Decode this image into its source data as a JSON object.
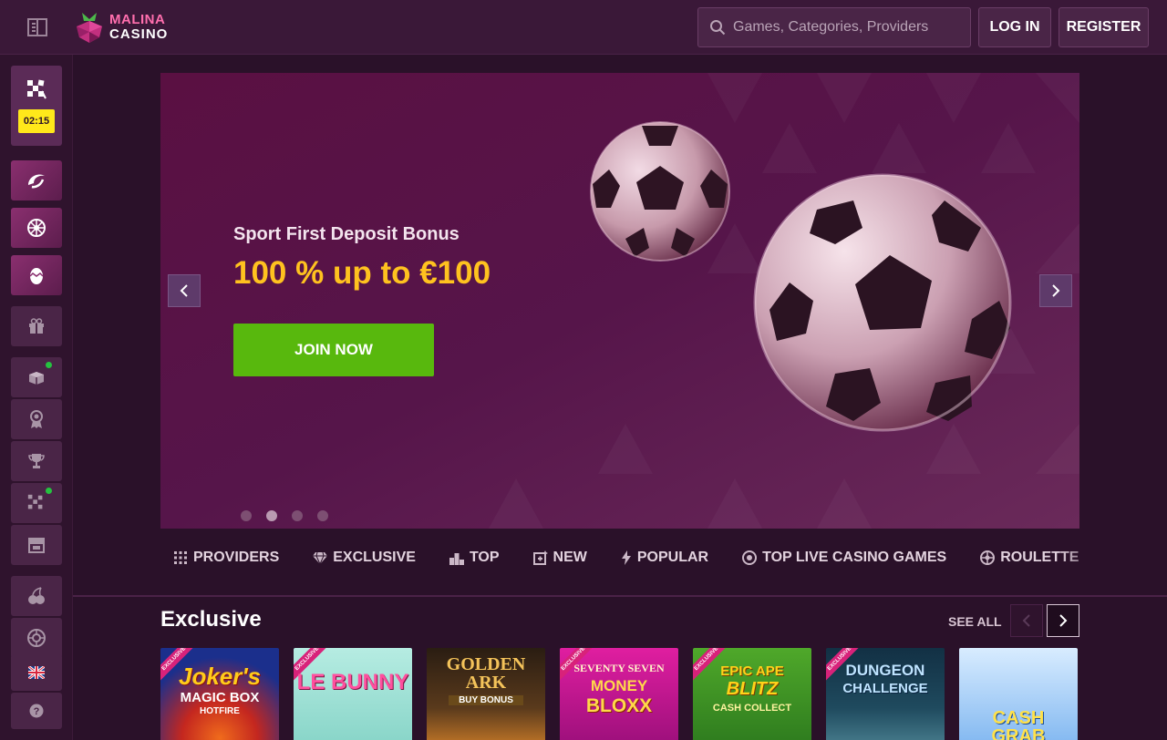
{
  "header": {
    "logo_line1": "MALINA",
    "logo_line2": "CASINO",
    "search_placeholder": "Games, Categories, Providers",
    "login_label": "LOG IN",
    "register_label": "REGISTER"
  },
  "sidebar": {
    "sport_timer": "02:15",
    "items": [
      {
        "icon": "sports-icon"
      },
      {
        "icon": "casino-icon"
      },
      {
        "icon": "live-casino-icon"
      },
      {
        "icon": "easter-egg-icon"
      },
      {
        "icon": "gift-icon"
      },
      {
        "icon": "promotions-icon",
        "notification": true
      },
      {
        "icon": "loyalty-icon"
      },
      {
        "icon": "tournaments-icon"
      },
      {
        "icon": "sport-events-icon",
        "notification": true
      },
      {
        "icon": "shop-icon"
      },
      {
        "icon": "fruits-icon"
      },
      {
        "icon": "roulette-icon"
      },
      {
        "icon": "uk-flag-icon"
      },
      {
        "icon": "help-icon"
      }
    ]
  },
  "hero": {
    "subtitle": "Sport First Deposit Bonus",
    "title": "100 % up to €100",
    "cta_label": "JOIN NOW",
    "slide_count": 4,
    "active_slide": 2
  },
  "categories": [
    {
      "label": "PROVIDERS",
      "icon": "grid-icon"
    },
    {
      "label": "EXCLUSIVE",
      "icon": "diamond-icon"
    },
    {
      "label": "TOP",
      "icon": "podium-icon"
    },
    {
      "label": "NEW",
      "icon": "new-icon"
    },
    {
      "label": "POPULAR",
      "icon": "lightning-icon"
    },
    {
      "label": "TOP LIVE CASINO GAMES",
      "icon": "live-chip-icon"
    },
    {
      "label": "ROULETTE",
      "icon": "roulette-icon"
    }
  ],
  "exclusive": {
    "title": "Exclusive",
    "see_all": "SEE ALL",
    "games": [
      {
        "name": "Joker's",
        "sub": "MAGIC BOX",
        "extra": "HOTFIRE",
        "ribbon": "EXCLUSIVE",
        "bg": "#1b2f8c"
      },
      {
        "name": "LE BUNNY",
        "sub": "",
        "extra": "",
        "ribbon": "EXCLUSIVE",
        "bg": "#9ee0d8"
      },
      {
        "name": "GOLDEN ARK",
        "sub": "BUY BONUS",
        "extra": "",
        "ribbon": "",
        "bg": "#3a2a1c"
      },
      {
        "name": "SEVENTY SEVEN",
        "sub": "MONEY",
        "extra": "BLOXX",
        "ribbon": "EXCLUSIVE",
        "bg": "#b01a8c"
      },
      {
        "name": "EPIC APE",
        "sub": "BLITZ",
        "extra": "CASH COLLECT",
        "ribbon": "EXCLUSIVE",
        "bg": "#2d7a1e"
      },
      {
        "name": "DUNGEON",
        "sub": "CHALLENGE",
        "extra": "",
        "ribbon": "EXCLUSIVE",
        "bg": "#1a3a4a"
      },
      {
        "name": "CASH",
        "sub": "GRAB",
        "extra": "",
        "ribbon": "",
        "bg": "#7fb6f0"
      }
    ]
  }
}
